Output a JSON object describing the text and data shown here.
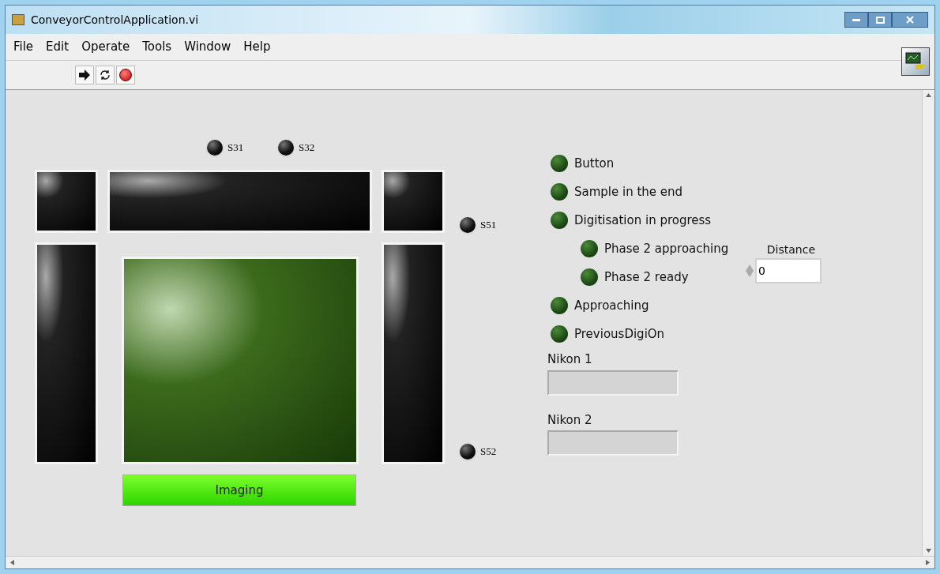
{
  "window": {
    "title": "ConveyorControlApplication.vi"
  },
  "menu": [
    "File",
    "Edit",
    "Operate",
    "Tools",
    "Window",
    "Help"
  ],
  "sensors": [
    {
      "label": "S31",
      "on": false
    },
    {
      "label": "S32",
      "on": false
    },
    {
      "label": "S51",
      "on": false
    },
    {
      "label": "S52",
      "on": false
    }
  ],
  "segments": [
    {
      "on": false
    },
    {
      "on": false
    },
    {
      "on": false
    },
    {
      "on": false
    },
    {
      "on": true
    },
    {
      "on": false
    }
  ],
  "imaging_button": {
    "label": "Imaging",
    "on": true
  },
  "indicators": [
    {
      "label": "Button",
      "on": false
    },
    {
      "label": "Sample in the end",
      "on": false
    },
    {
      "label": "Digitisation in progress",
      "on": false,
      "children": [
        {
          "label": "Phase 2 approaching",
          "on": false
        },
        {
          "label": "Phase 2 ready",
          "on": false
        }
      ]
    },
    {
      "label": "Approaching",
      "on": false
    },
    {
      "label": "PreviousDigiOn",
      "on": false
    }
  ],
  "distance": {
    "label": "Distance",
    "value": "0"
  },
  "string_indicators": [
    {
      "label": "Nikon 1"
    },
    {
      "label": "Nikon 2"
    }
  ]
}
